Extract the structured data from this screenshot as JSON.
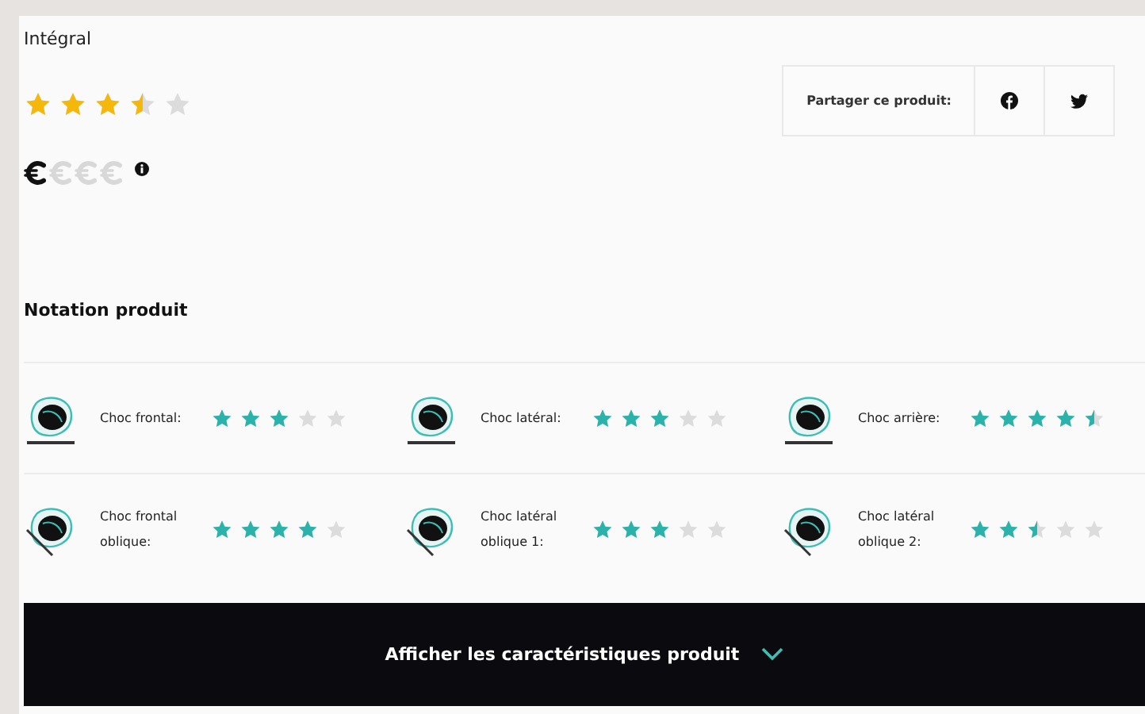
{
  "product": {
    "name": "Intégral",
    "stars": 3.5,
    "price_symbols": [
      {
        "filled": true
      },
      {
        "filled": false
      },
      {
        "filled": false
      },
      {
        "filled": false
      }
    ],
    "share": {
      "label": "Partager ce produit:"
    }
  },
  "rating_section": {
    "title": "Notation produit",
    "rows": [
      {
        "items": [
          {
            "kind": "flat",
            "label": "Choc frontal:",
            "stars": 3
          },
          {
            "kind": "flat",
            "label": "Choc latéral:",
            "stars": 3
          },
          {
            "kind": "flat",
            "label": "Choc arrière:",
            "stars": 4.5
          }
        ]
      },
      {
        "items": [
          {
            "kind": "oblique",
            "label": "Choc frontal oblique:",
            "stars": 4
          },
          {
            "kind": "oblique",
            "label": "Choc latéral oblique 1:",
            "stars": 3
          },
          {
            "kind": "oblique",
            "label": "Choc latéral oblique 2:",
            "stars": 2.5
          }
        ]
      }
    ]
  },
  "details_button": {
    "label": "Afficher les caractéristiques produit"
  }
}
